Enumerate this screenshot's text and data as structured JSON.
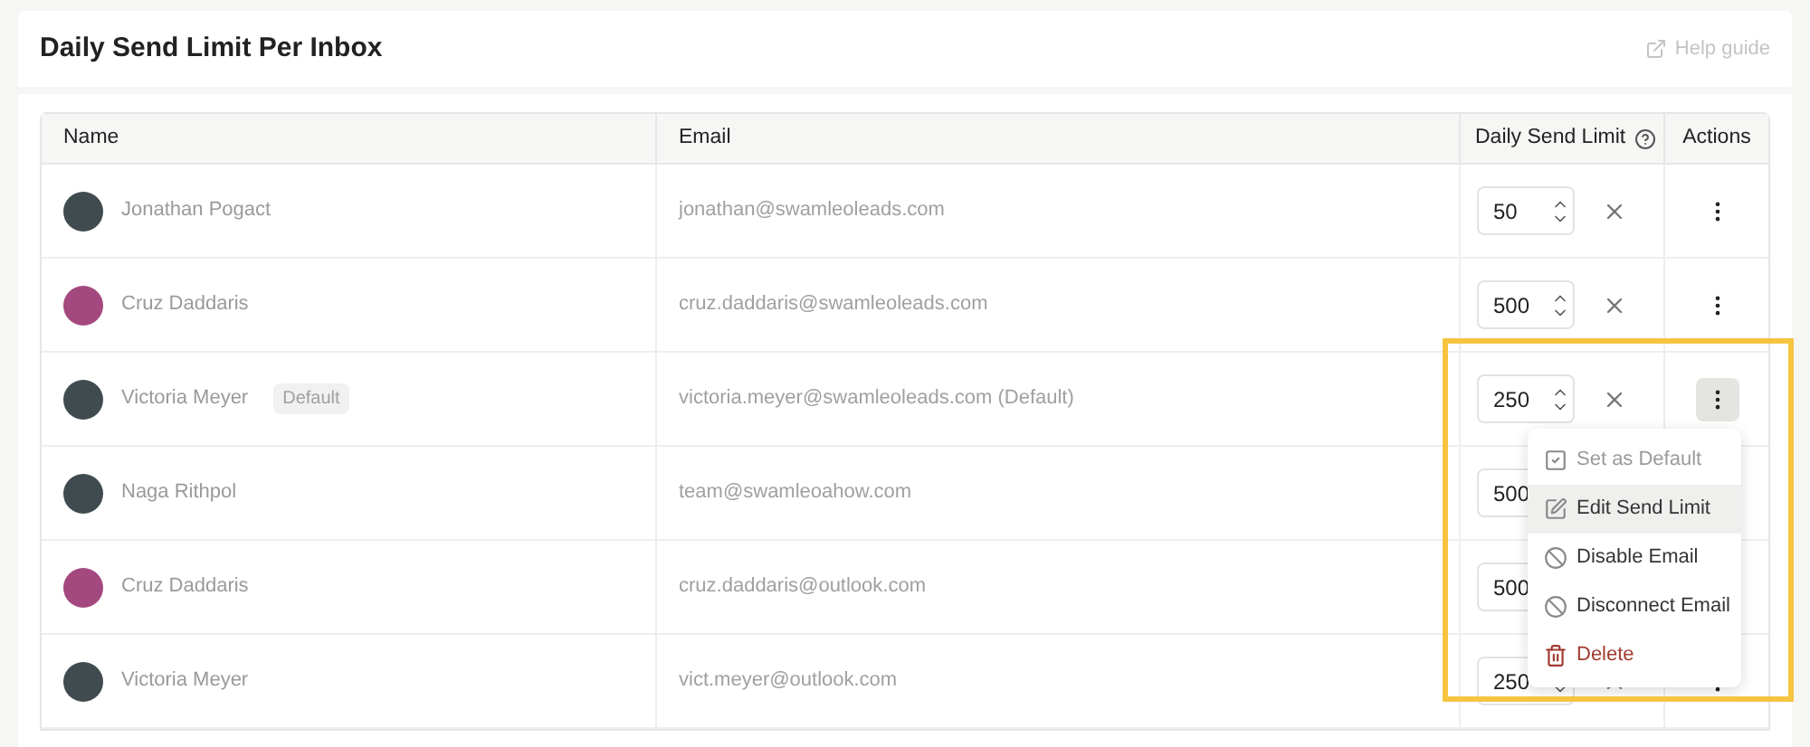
{
  "header": {
    "title": "Daily Send Limit Per Inbox",
    "help_link": "Help guide"
  },
  "table": {
    "columns": [
      {
        "label": "Name"
      },
      {
        "label": "Email"
      },
      {
        "label": "Daily Send Limit",
        "help": true
      },
      {
        "label": "Actions"
      }
    ],
    "rows": [
      {
        "name": "Jonathan Pogact",
        "color": "#3f4b4f",
        "email": "jonathan@swamleoleads.com",
        "limit": "50",
        "menu_open": false
      },
      {
        "name": "Cruz Daddaris",
        "color": "#a4497f",
        "email": "cruz.daddaris@swamleoleads.com",
        "limit": "500",
        "menu_open": false
      },
      {
        "name": "Victoria Meyer",
        "badge": "Default",
        "color": "#3f4b4f",
        "email": "victoria.meyer@swamleoleads.com (Default)",
        "limit": "250",
        "menu_open": true
      },
      {
        "name": "Naga Rithpol",
        "color": "#3f4b4f",
        "email": "team@swamleoahow.com",
        "limit": "500"
      },
      {
        "name": "Cruz Daddaris",
        "color": "#a4497f",
        "email": "cruz.daddaris@outlook.com",
        "limit": "500"
      },
      {
        "name": "Victoria Meyer",
        "color": "#3f4b4f",
        "email": "vict.meyer@outlook.com",
        "limit": "250",
        "menu_open": false
      }
    ]
  },
  "menu": {
    "items": [
      {
        "kind": "default",
        "label": "Set as Default",
        "disabled": true,
        "selected": false
      },
      {
        "kind": "edit",
        "label": "Edit Send Limit",
        "disabled": false,
        "selected": true
      },
      {
        "kind": "disable",
        "label": "Disable Email",
        "disabled": false,
        "selected": false
      },
      {
        "kind": "disconnect",
        "label": "Disconnect Email",
        "disabled": false,
        "selected": false
      },
      {
        "kind": "delete",
        "label": "Delete",
        "disabled": false,
        "selected": false
      }
    ]
  }
}
